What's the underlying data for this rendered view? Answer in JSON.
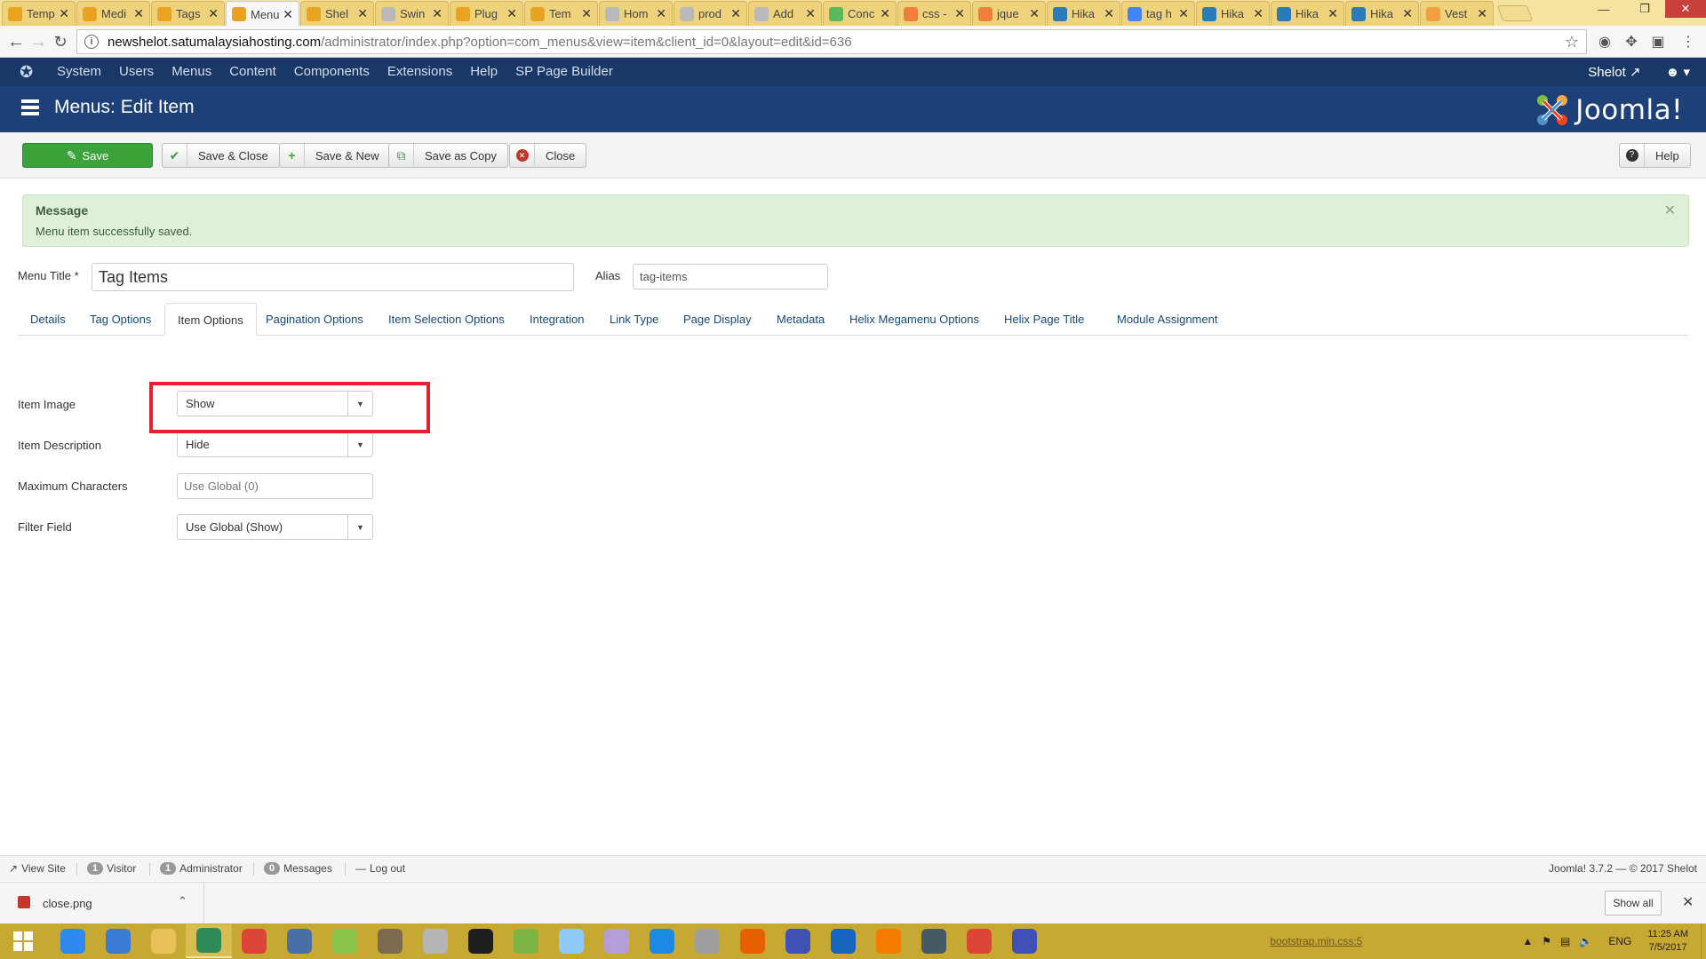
{
  "browser": {
    "tabs": [
      {
        "label": "Temp",
        "fav": "#e9a320"
      },
      {
        "label": "Medi",
        "fav": "#e9a320"
      },
      {
        "label": "Tags",
        "fav": "#e9a320"
      },
      {
        "label": "Menu",
        "fav": "#e9a320",
        "active": true
      },
      {
        "label": "Shel",
        "fav": "#e9a320"
      },
      {
        "label": "Swin",
        "fav": "#b9b9b9"
      },
      {
        "label": "Plug",
        "fav": "#e9a320"
      },
      {
        "label": "Tem",
        "fav": "#e9a320"
      },
      {
        "label": "Hom",
        "fav": "#b9b9b9"
      },
      {
        "label": "prod",
        "fav": "#b9b9b9"
      },
      {
        "label": "Add",
        "fav": "#b9b9b9"
      },
      {
        "label": "Conc",
        "fav": "#5cb85c"
      },
      {
        "label": "css -",
        "fav": "#f07f3c"
      },
      {
        "label": "jque",
        "fav": "#f07f3c"
      },
      {
        "label": "Hika",
        "fav": "#2b7bb9"
      },
      {
        "label": "tag h",
        "fav": "#4285f4"
      },
      {
        "label": "Hika",
        "fav": "#2b7bb9"
      },
      {
        "label": "Hika",
        "fav": "#2b7bb9"
      },
      {
        "label": "Hika",
        "fav": "#2b7bb9"
      },
      {
        "label": "Vest",
        "fav": "#f0a040"
      }
    ],
    "close_glyph": "✕",
    "url_host": "newshelot.satumalaysiahosting.com",
    "url_path": "/administrator/index.php?option=com_menus&view=item&client_id=0&layout=edit&id=636"
  },
  "joomla": {
    "menu": [
      "System",
      "Users",
      "Menus",
      "Content",
      "Components",
      "Extensions",
      "Help",
      "SP Page Builder"
    ],
    "user_site": "Shelot",
    "page_title": "Menus: Edit Item",
    "brand": "Joomla!"
  },
  "toolbar": {
    "save": "Save",
    "save_close": "Save & Close",
    "save_new": "Save & New",
    "save_copy": "Save as Copy",
    "close": "Close",
    "help": "Help"
  },
  "message": {
    "heading": "Message",
    "text": "Menu item successfully saved."
  },
  "form": {
    "menu_title_label": "Menu Title *",
    "menu_title_value": "Tag Items",
    "alias_label": "Alias",
    "alias_value": "tag-items"
  },
  "edit_tabs": [
    "Details",
    "Tag Options",
    "Item Options",
    "Pagination Options",
    "Item Selection Options",
    "Integration",
    "Link Type",
    "Page Display",
    "Metadata",
    "Helix Megamenu Options",
    "Helix Page Title",
    "Module Assignment"
  ],
  "options": {
    "item_image_label": "Item Image",
    "item_image_value": "Show",
    "item_description_label": "Item Description",
    "item_description_value": "Hide",
    "max_chars_label": "Maximum Characters",
    "max_chars_placeholder": "Use Global (0)",
    "filter_field_label": "Filter Field",
    "filter_field_value": "Use Global (Show)"
  },
  "status": {
    "view_site": "View Site",
    "visitor_count": "1",
    "visitor": "Visitor",
    "admin_count": "1",
    "administrator": "Administrator",
    "messages_count": "0",
    "messages": "Messages",
    "logout": "Log out",
    "version": "Joomla! 3.7.2 — © 2017 Shelot"
  },
  "downloads": {
    "file": "close.png",
    "show_all": "Show all"
  },
  "taskbar": {
    "apps": [
      "#2d89ef",
      "#3a7bd5",
      "#e8c05a",
      "#2e8b57",
      "#db4437",
      "#4a6fa5",
      "#8bc34a",
      "#7b6a4e",
      "#b5b5b5",
      "#1e1e1e",
      "#7cb342",
      "#90caf9",
      "#b39ddb",
      "#1e88e5",
      "#9e9e9e",
      "#e66000",
      "#3f51b5",
      "#1565c0",
      "#f57c00",
      "#455a64",
      "#db4437",
      "#3f51b5"
    ],
    "tray_text": "bootstrap.min.css:5",
    "lang": "ENG",
    "time": "11:25 AM",
    "date": "7/5/2017"
  }
}
